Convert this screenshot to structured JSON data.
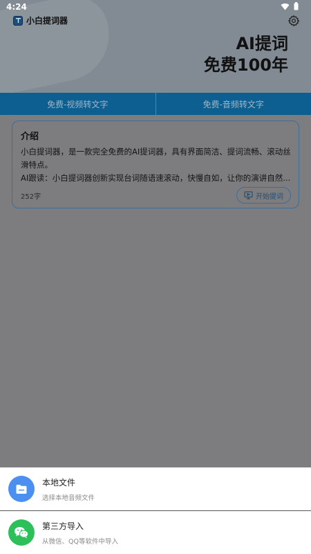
{
  "status_bar": {
    "time": "4:24"
  },
  "app": {
    "title": "小白提词器",
    "slogan_line1": "AI提词",
    "slogan_line2": "免费100年"
  },
  "tabs": [
    {
      "label": "免费-视频转文字"
    },
    {
      "label": "免费-音频转文字"
    }
  ],
  "intro_card": {
    "title": "介绍",
    "line1": "小白提词器，是一款完全免费的AI提词器，具有界面简洁、提词流畅、滚动丝滑特点。",
    "line2": "AI跟读：小白提词器创新实现台词随语速滚动，快慢自如，让你的演讲自然...",
    "char_count": "252字",
    "start_label": "开始提词"
  },
  "import_sheet": {
    "items": [
      {
        "label": "本地文件",
        "sub": "选择本地音频文件",
        "icon": "folder-icon",
        "color": "#4b8ff0"
      },
      {
        "label": "第三方导入",
        "sub": "从微信、QQ等软件中导入",
        "icon": "wechat-icon",
        "color": "#2dc05a"
      }
    ]
  },
  "colors": {
    "accent": "#0e5f91",
    "card_border": "#3b6e99"
  }
}
